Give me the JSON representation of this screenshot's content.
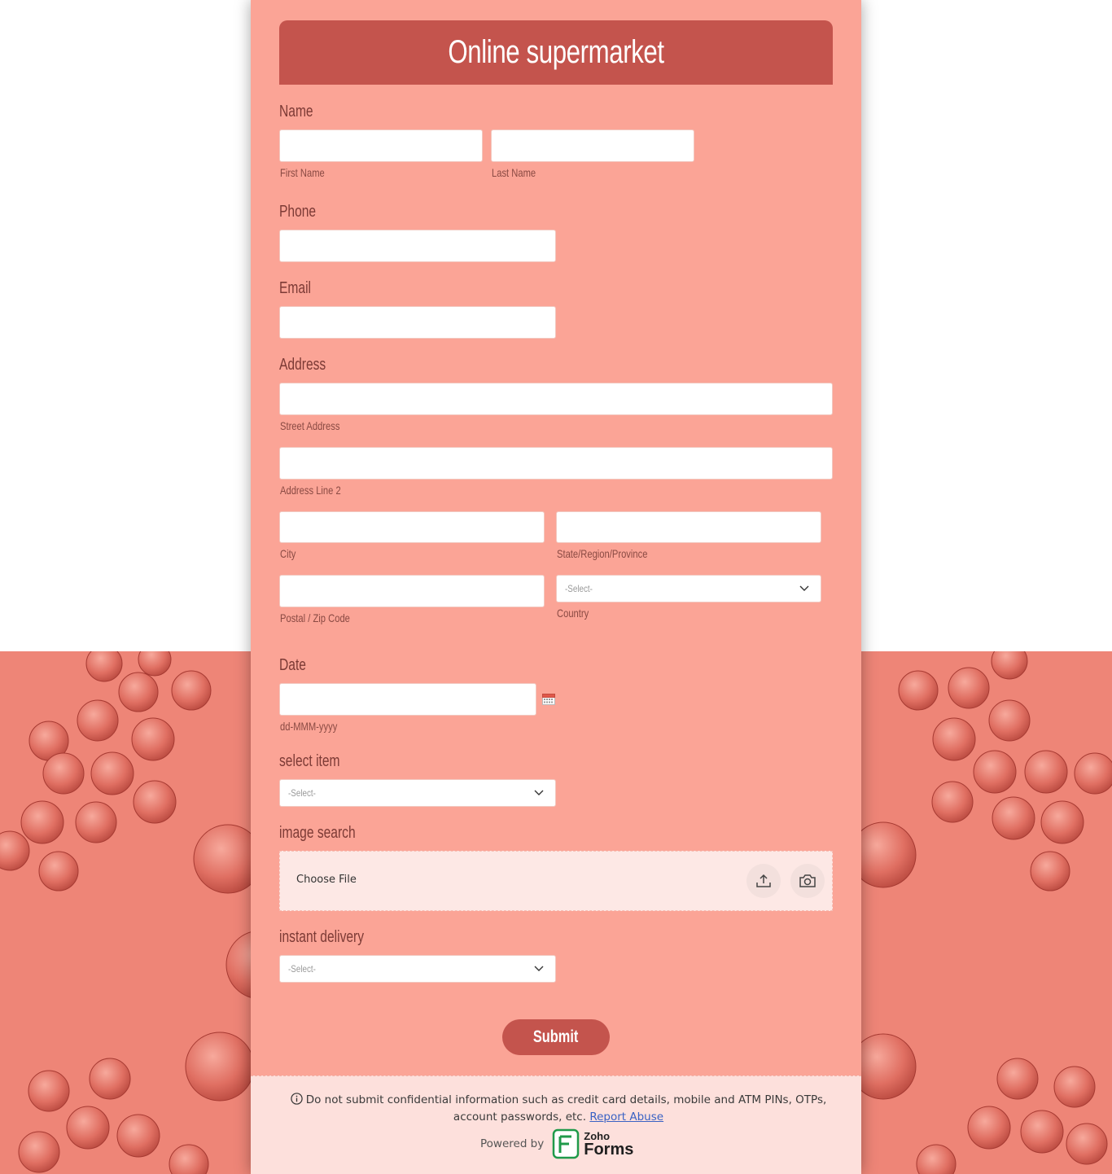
{
  "form": {
    "title": "Online supermarket",
    "name": {
      "label": "Name",
      "first_sub": "First Name",
      "last_sub": "Last Name"
    },
    "phone": {
      "label": "Phone"
    },
    "email": {
      "label": "Email"
    },
    "address": {
      "label": "Address",
      "street_sub": "Street Address",
      "line2_sub": "Address Line 2",
      "city_sub": "City",
      "state_sub": "State/Region/Province",
      "zip_sub": "Postal / Zip Code",
      "country_sub": "Country",
      "country_value": "-Select-"
    },
    "date": {
      "label": "Date",
      "format_sub": "dd-MMM-yyyy"
    },
    "select_item": {
      "label": "select item",
      "value": "-Select-"
    },
    "image_search": {
      "label": "image search",
      "choose_file": "Choose File"
    },
    "instant_delivery": {
      "label": "instant delivery",
      "value": "-Select-"
    },
    "submit_label": "Submit"
  },
  "footer": {
    "note": "Do not submit confidential information such as credit card details, mobile and ATM PINs, OTPs, account passwords, etc.",
    "report_link": "Report Abuse",
    "powered_by": "Powered by",
    "brand_top": "Zoho",
    "brand_bottom": "Forms"
  },
  "colors": {
    "card": "#fba496",
    "header": "#c4544d",
    "page_bottom": "#ee8577",
    "footer": "#fde0dc"
  },
  "icons": [
    "calendar-icon",
    "chevron-down-icon",
    "upload-icon",
    "camera-icon",
    "info-icon",
    "zoho-forms-logo"
  ]
}
